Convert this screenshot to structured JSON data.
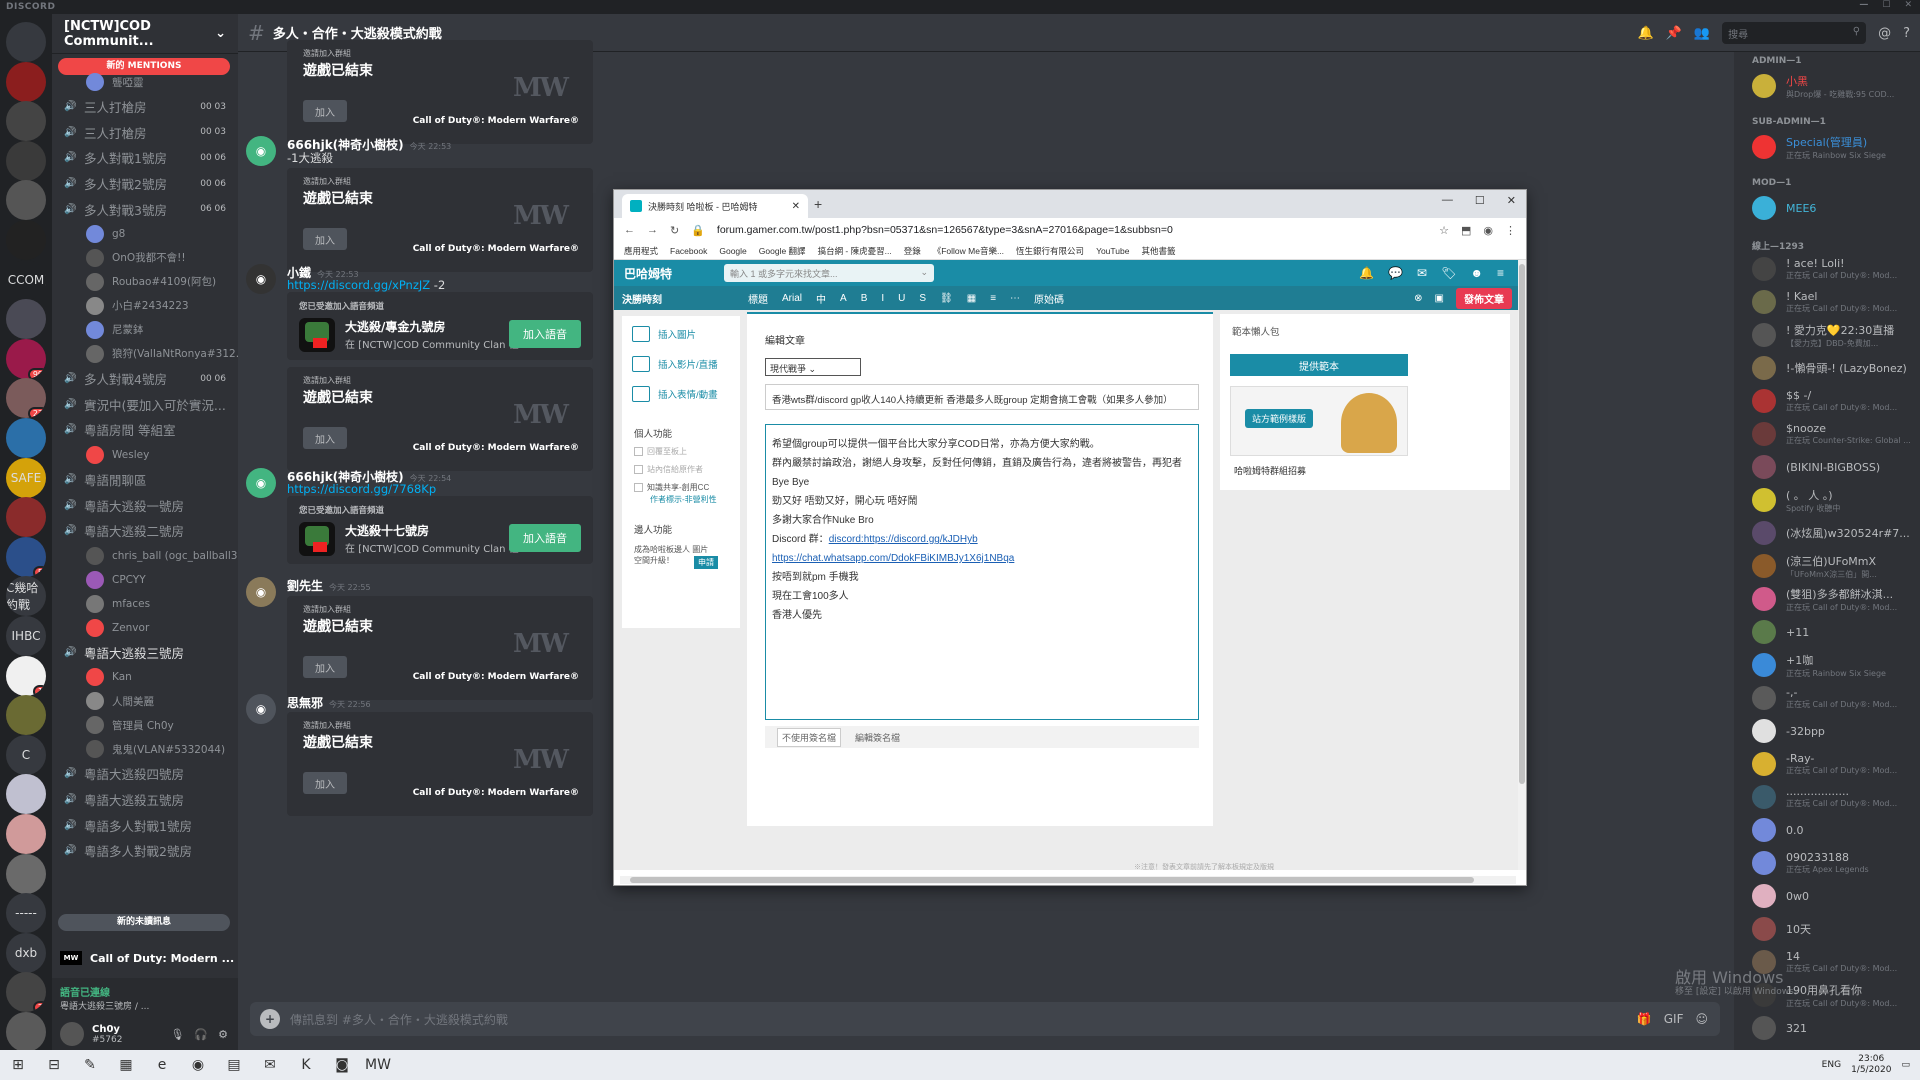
{
  "app": {
    "brand": "DISCORD",
    "window_controls": [
      "—",
      "☐",
      "✕"
    ]
  },
  "guilds": [
    {
      "label": "",
      "color": "#36393f"
    },
    {
      "label": "",
      "color": "#8b1e1e"
    },
    {
      "label": "",
      "color": "#444444"
    },
    {
      "label": "",
      "color": "#3a3a3a"
    },
    {
      "label": "",
      "color": "#555555"
    },
    {
      "label": "",
      "color": "#222222"
    },
    {
      "label": "[CCOM]",
      "color": "#202225"
    },
    {
      "label": "",
      "color": "#4a4a55"
    },
    {
      "label": "",
      "color": "#9a1a4a",
      "badge": "99"
    },
    {
      "label": "",
      "color": "#7b5b5b",
      "badge": "23"
    },
    {
      "label": "",
      "color": "#2b6fa8"
    },
    {
      "label": "SAFE",
      "color": "#d4a20a",
      "badge": "1"
    },
    {
      "label": "",
      "color": "#8a2b2b"
    },
    {
      "label": "",
      "color": "#2b4f8a",
      "badge": "5"
    },
    {
      "label": "C幾哈約戰",
      "color": "#36393f"
    },
    {
      "label": "IHBC",
      "color": "#36393f",
      "badge": "4"
    },
    {
      "label": "",
      "color": "#f0f0f0",
      "badge": "1"
    },
    {
      "label": "",
      "color": "#6a6a33"
    },
    {
      "label": "C",
      "color": "#36393f"
    },
    {
      "label": "",
      "color": "#c0c0d0"
    },
    {
      "label": "",
      "color": "#d09a9a"
    },
    {
      "label": "",
      "color": "#6a6a6a"
    },
    {
      "label": "-----",
      "color": "#36393f"
    },
    {
      "label": "dxb",
      "color": "#36393f"
    },
    {
      "label": "",
      "color": "#444444",
      "badge": "2"
    },
    {
      "label": "",
      "color": "#5a5a5a"
    }
  ],
  "server": {
    "name": "[NCTW]COD Communit...",
    "mentions_pill": "新的 MENTIONS",
    "new_unread": "新的未讀訊息",
    "channels": [
      {
        "kind": "user",
        "name": "聾啞靈",
        "color": "#7289da"
      },
      {
        "kind": "voice",
        "name": "三人打槍房",
        "count": "00 03"
      },
      {
        "kind": "voice",
        "name": "三人打槍房",
        "count": "00 03"
      },
      {
        "kind": "voice",
        "name": "多人對戰1號房",
        "count": "00 06"
      },
      {
        "kind": "voice",
        "name": "多人對戰2號房",
        "count": "00 06"
      },
      {
        "kind": "voice",
        "name": "多人對戰3號房",
        "count": "06 06"
      },
      {
        "kind": "user",
        "name": "g8",
        "color": "#7289da"
      },
      {
        "kind": "user",
        "name": "OnO我都不會!!",
        "color": "#555555"
      },
      {
        "kind": "user",
        "name": "Roubao#4109(阿包)",
        "color": "#666666"
      },
      {
        "kind": "user",
        "name": "小白#2434223",
        "color": "#888888"
      },
      {
        "kind": "user",
        "name": "尼蒙鉢",
        "color": "#7289da"
      },
      {
        "kind": "user",
        "name": "狼狩(ValIaNtRonya#312...",
        "color": "#666666"
      },
      {
        "kind": "voice",
        "name": "多人對戰4號房",
        "count": "00 06"
      },
      {
        "kind": "voice",
        "name": "實況中(要加入可於實況...",
        "count": ""
      },
      {
        "kind": "voice",
        "name": "粵語房間 等組室",
        "count": ""
      },
      {
        "kind": "user",
        "name": "Wesley",
        "color": "#f04747"
      },
      {
        "kind": "voice",
        "name": "粵語閒聊區",
        "count": ""
      },
      {
        "kind": "voice",
        "name": "粵語大逃殺一號房",
        "count": ""
      },
      {
        "kind": "voice",
        "name": "粵語大逃殺二號房",
        "count": ""
      },
      {
        "kind": "user",
        "name": "chris_ball (ogc_ballball3...",
        "color": "#555555"
      },
      {
        "kind": "user",
        "name": "CPCYY",
        "color": "#9b59b6"
      },
      {
        "kind": "user",
        "name": "mfaces",
        "color": "#777777"
      },
      {
        "kind": "user",
        "name": "Zenvor",
        "color": "#f04747"
      },
      {
        "kind": "voice-bold",
        "name": "粵語大逃殺三號房",
        "count": ""
      },
      {
        "kind": "user",
        "name": "Kan",
        "color": "#f04747"
      },
      {
        "kind": "user",
        "name": "人間美麗",
        "color": "#888888"
      },
      {
        "kind": "user",
        "name": "管理員 Ch0y",
        "color": "#666666"
      },
      {
        "kind": "user",
        "name": "鬼鬼(VLAN#5332044)",
        "color": "#555555"
      },
      {
        "kind": "voice",
        "name": "粵語大逃殺四號房",
        "count": ""
      },
      {
        "kind": "voice",
        "name": "粵語大逃殺五號房",
        "count": ""
      },
      {
        "kind": "voice",
        "name": "粵語多人對戰1號房",
        "count": ""
      },
      {
        "kind": "voice",
        "name": "粵語多人對戰2號房",
        "count": ""
      }
    ],
    "game": {
      "logo": "MW",
      "name": "Call of Duty: Modern ..."
    },
    "voice_status": "語音已連線",
    "voice_channel": "粵語大逃殺三號房 / ...",
    "user": {
      "name": "Ch0y",
      "tag": "#5762"
    }
  },
  "channel": {
    "hash": "#",
    "name": "多人・合作・大逃殺模式約戰",
    "search_placeholder": "搜尋",
    "composer_placeholder": "傳訊息到 #多人・合作・大逃殺模式約戰"
  },
  "messages": [
    {
      "type": "embed",
      "small": "邀請加入群組",
      "big": "遊戲已結束",
      "join": "加入",
      "mw": "MW",
      "game": "Call of Duty®: Modern Warfare®"
    },
    {
      "type": "msg",
      "author": "666hjk(神奇小樹枝)",
      "ts": "今天 22:53",
      "text": "-1大逃殺",
      "avatar": "#43b581"
    },
    {
      "type": "embed",
      "small": "邀請加入群組",
      "big": "遊戲已結束",
      "join": "加入",
      "mw": "MW",
      "game": "Call of Duty®: Modern Warfare®"
    },
    {
      "type": "msg",
      "author": "小鐵",
      "ts": "今天 22:53",
      "link": "https://discord.gg/xPnzJZ",
      "text": " -2",
      "avatar": "#333333"
    },
    {
      "type": "invite",
      "small": "您已受邀加入語音頻道",
      "voice": "大逃殺/專金九號房",
      "server": "在 [NCTW]COD Community Clan 社...",
      "button": "加入語音"
    },
    {
      "type": "embed",
      "small": "邀請加入群組",
      "big": "遊戲已結束",
      "join": "加入",
      "mw": "MW",
      "game": "Call of Duty®: Modern Warfare®"
    },
    {
      "type": "msg",
      "author": "666hjk(神奇小樹枝)",
      "ts": "今天 22:54",
      "link": "https://discord.gg/7768Kp",
      "text": "",
      "avatar": "#43b581"
    },
    {
      "type": "invite",
      "small": "您已受邀加入語音頻道",
      "voice": "大逃殺十七號房",
      "server": "在 [NCTW]COD Community Clan 社...",
      "button": "加入語音"
    },
    {
      "type": "msg",
      "author": "劉先生",
      "ts": "今天 22:55",
      "text": "",
      "avatar": "#8a7a5a"
    },
    {
      "type": "embed",
      "small": "邀請加入群組",
      "big": "遊戲已結束",
      "join": "加入",
      "mw": "MW",
      "game": "Call of Duty®: Modern Warfare®"
    },
    {
      "type": "msg",
      "author": "思無邪",
      "ts": "今天 22:56",
      "text": "",
      "avatar": "#4f545c"
    },
    {
      "type": "embed",
      "small": "邀請加入群組",
      "big": "遊戲已結束",
      "join": "加入",
      "mw": "MW",
      "game": "Call of Duty®: Modern Warfare®"
    }
  ],
  "members": {
    "groups": [
      {
        "label": "ADMIN—1",
        "items": [
          {
            "name": "小黑",
            "activity": "與Drop爆 - 吃雞戰:95 COD...",
            "color": "#f04747",
            "av": "#c9b03a"
          }
        ]
      },
      {
        "label": "SUB-ADMIN—1",
        "items": [
          {
            "name": "Special(管理員)",
            "activity": "正在玩 Rainbow Six Siege",
            "color": "#3b8fd8",
            "av": "#e33"
          }
        ]
      },
      {
        "label": "MOD—1",
        "items": [
          {
            "name": "MEE6",
            "activity": "",
            "color": "#43b5d8",
            "av": "#3ab0d8"
          }
        ]
      },
      {
        "label": "線上—1293",
        "items": [
          {
            "name": "! ace! Loli!",
            "activity": "正在玩 Call of Duty®: Mod...",
            "color": "#b9bbbe",
            "av": "#444"
          },
          {
            "name": "! Kael",
            "activity": "正在玩 Call of Duty®: Mod...",
            "color": "#b9bbbe",
            "av": "#6a6a4a"
          },
          {
            "name": "! 愛力克💛22:30直播",
            "activity": "【愛力克】DBD-免費加...",
            "color": "#b9bbbe",
            "av": "#555"
          },
          {
            "name": "!-懶骨頭-! (LazyBonez)",
            "activity": "",
            "color": "#b9bbbe",
            "av": "#7a6a4a"
          },
          {
            "name": "$$ -/",
            "activity": "正在玩 Call of Duty®: Mod...",
            "color": "#b9bbbe",
            "av": "#a33"
          },
          {
            "name": "$nooze",
            "activity": "正在玩 Counter-Strike: Global ...",
            "color": "#b9bbbe",
            "av": "#6a3a3a"
          },
          {
            "name": "(BIKINI-BIGBOSS)",
            "activity": "",
            "color": "#b9bbbe",
            "av": "#7a4a5a"
          },
          {
            "name": "( 。 人 。)",
            "activity": "Spotify 收聽中",
            "color": "#b9bbbe",
            "av": "#d0c030"
          },
          {
            "name": "(冰炫風)w320524r#7...",
            "activity": "",
            "color": "#b9bbbe",
            "av": "#5a4a6a"
          },
          {
            "name": "(涼三伯)UFoMmX",
            "activity": "「UFoMmX涼三伯」開...",
            "color": "#b9bbbe",
            "av": "#8a5a2a"
          },
          {
            "name": "(雙狙)多多都餅冰淇...",
            "activity": "正在玩 Call of Duty®: Mod...",
            "color": "#b9bbbe",
            "av": "#d05a8a"
          },
          {
            "name": "+11",
            "activity": "",
            "color": "#b9bbbe",
            "av": "#5a7a4a"
          },
          {
            "name": "+1咖",
            "activity": "正在玩 Rainbow Six Siege",
            "color": "#b9bbbe",
            "av": "#3a8ad8"
          },
          {
            "name": "-,-",
            "activity": "正在玩 Call of Duty®: Mod...",
            "color": "#b9bbbe",
            "av": "#5a5a5a"
          },
          {
            "name": "-32bpp",
            "activity": "",
            "color": "#b9bbbe",
            "av": "#e0e0e0"
          },
          {
            "name": "-Ray-",
            "activity": "正在玩 Call of Duty®: Mod...",
            "color": "#b9bbbe",
            "av": "#d8b030"
          },
          {
            "name": "..................",
            "activity": "正在玩 Call of Duty®: Mod...",
            "color": "#b9bbbe",
            "av": "#3a5a6a"
          },
          {
            "name": "0.0",
            "activity": "",
            "color": "#b9bbbe",
            "av": "#7289da"
          },
          {
            "name": "090233188",
            "activity": "正在玩 Apex Legends",
            "color": "#b9bbbe",
            "av": "#7289da"
          },
          {
            "name": "0w0",
            "activity": "",
            "color": "#b9bbbe",
            "av": "#e0b0c0"
          },
          {
            "name": "10天",
            "activity": "",
            "color": "#b9bbbe",
            "av": "#8a4a4a"
          },
          {
            "name": "14",
            "activity": "正在玩 Call of Duty®: Mod...",
            "color": "#b9bbbe",
            "av": "#6a5a4a"
          },
          {
            "name": "190用鼻孔看你",
            "activity": "正在玩 Call of Duty®: Mod...",
            "color": "#b9bbbe",
            "av": "#3a3a3a"
          },
          {
            "name": "321",
            "activity": "",
            "color": "#b9bbbe",
            "av": "#555"
          }
        ]
      }
    ]
  },
  "watermark": {
    "line1": "啟用 Windows",
    "line2": "移至 [設定] 以啟用 Windows。"
  },
  "taskbar": {
    "icons": [
      "⊞",
      "⊟",
      "✎",
      "▦",
      "e",
      "◉",
      "▤",
      "✉",
      "K",
      "◙",
      "MW"
    ],
    "lang": "ENG",
    "time": "23:06",
    "date": "1/5/2020"
  },
  "browser": {
    "tab_title": "決勝時刻 哈啦板 - 巴哈姆特",
    "url": "forum.gamer.com.tw/post1.php?bsn=05371&sn=126567&type=3&snA=27016&page=1&subbsn=0",
    "bookmarks": [
      "應用程式",
      "Facebook",
      "Google",
      "Google 翻譯",
      "搞台網 - 陳虎憂習...",
      "登錄",
      "《Follow Me音樂...",
      "恆生銀行有限公司",
      "YouTube",
      "其他書籤"
    ],
    "site": {
      "logo": "巴哈姆特",
      "search_placeholder": "輸入 1 或多字元來找文章...",
      "board": "決勝時刻",
      "tools": [
        "標題",
        "Arial",
        "中",
        "A",
        "B",
        "I",
        "U",
        "S",
        "⛓",
        "▦",
        "≡",
        "⋯",
        "原始碼"
      ],
      "publish": "發佈文章"
    },
    "side": {
      "insert_image": "插入圖片",
      "insert_video": "插入影片/直播",
      "insert_emoji": "插入表情/動畫",
      "personal": "個人功能",
      "opt1": "回覆至板上",
      "opt2": "站內信給原作者",
      "opt3": "知識共享-創用CC",
      "opt3b": "作者標示-非營利性",
      "group": "邊人功能",
      "upgrade": "成為哈啦板邊人 圖片空間升級！",
      "upgrade_btn": "申請"
    },
    "editor": {
      "heading": "編輯文章",
      "category": "現代戰爭",
      "title": "香港wts群/discord gp收人140人持續更新 香港最多人既group 定期會搞工會戰（如果多人參加）",
      "body": [
        {
          "t": "希望個group可以提供一個平台比大家分享COD日常，亦為方便大家約戰。"
        },
        {
          "t": "群內嚴禁討論政治，謝絕人身攻擊，反對任何傳銷，直銷及廣告行為，違者將被警告，再犯者Bye Bye"
        },
        {
          "t": "勁又好 唔勁又好，開心玩 唔好鬧"
        },
        {
          "t": "多謝大家合作Nuke Bro"
        },
        {
          "t": "Discord 群：",
          "u": "discord:https://discord.gg/kJDHyb"
        },
        {
          "t": "",
          "u": "https://chat.whatsapp.com/DdokFBiKIMBJy1X6j1NBqa"
        },
        {
          "t": "按唔到就pm 手機我"
        },
        {
          "t": "現在工會100多人"
        },
        {
          "t": "香港人優先"
        }
      ],
      "sign_select": "不使用簽名檔",
      "sign_edit": "編輯簽名檔"
    },
    "template": {
      "heading": "範本懶人包",
      "button": "提供範本",
      "badge": "站方範例樣版",
      "caption": "哈啦姆特群組招募"
    },
    "footer_note": "※注意！發表文章前請先了解本板規定及版規"
  }
}
